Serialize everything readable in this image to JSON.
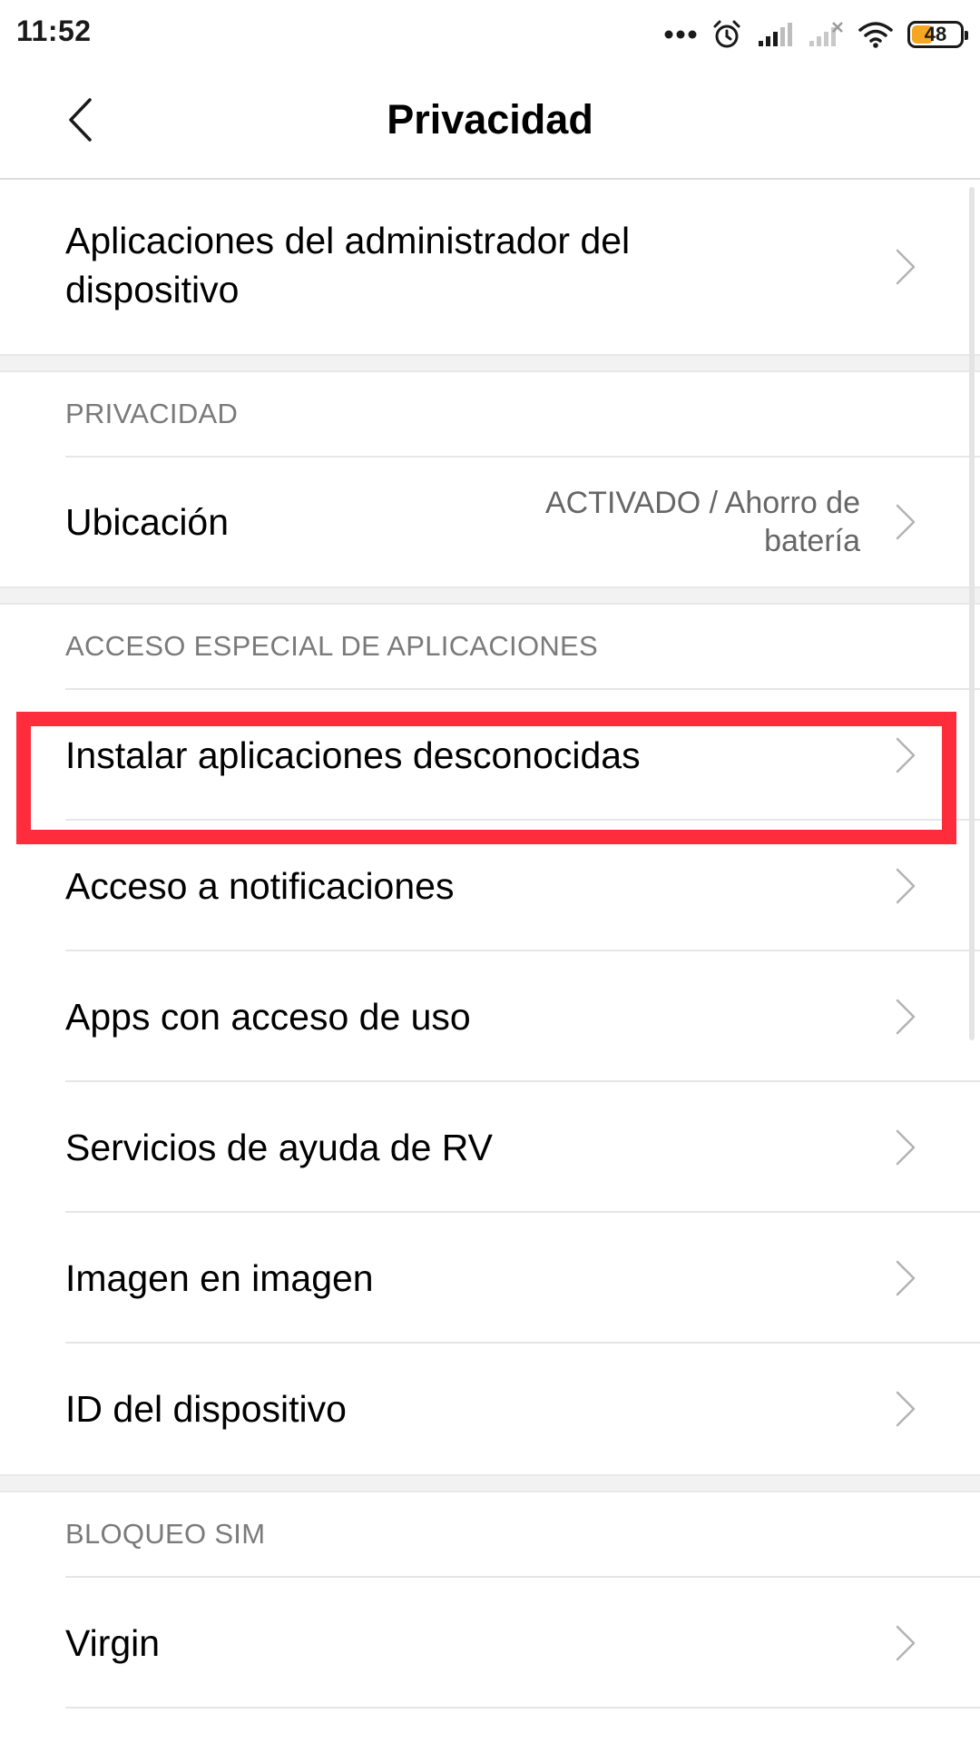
{
  "status_bar": {
    "time": "11:52",
    "icons": [
      "more-dots-icon",
      "alarm-icon",
      "signal-icon",
      "signal-no-service-icon",
      "wifi-icon",
      "battery-icon"
    ],
    "battery_level": "48",
    "battery_fraction": 0.48,
    "battery_color": "#f5a623"
  },
  "header": {
    "title": "Privacidad",
    "back_icon": "chevron-left-icon"
  },
  "device_admin": {
    "label_line1": "Aplicaciones del administrador del",
    "label_line2": "dispositivo"
  },
  "section_privacy": {
    "header": "PRIVACIDAD",
    "location": {
      "label": "Ubicación",
      "value_line1": "ACTIVADO / Ahorro de",
      "value_line2": "batería"
    }
  },
  "section_special_access": {
    "header": "ACCESO ESPECIAL DE APLICACIONES",
    "items": [
      {
        "label": "Instalar aplicaciones desconocidas"
      },
      {
        "label": "Acceso a notificaciones"
      },
      {
        "label": "Apps con acceso de uso"
      },
      {
        "label": "Servicios de ayuda de RV"
      },
      {
        "label": "Imagen en imagen"
      },
      {
        "label": "ID del dispositivo"
      }
    ]
  },
  "section_sim_lock": {
    "header": "BLOQUEO SIM",
    "items": [
      {
        "label": "Virgin"
      }
    ]
  },
  "colors": {
    "highlight": "#ff2d3b",
    "section_header_text": "#7a7a7a",
    "secondary_text": "#666666",
    "chevron": "#b3b3b3"
  }
}
